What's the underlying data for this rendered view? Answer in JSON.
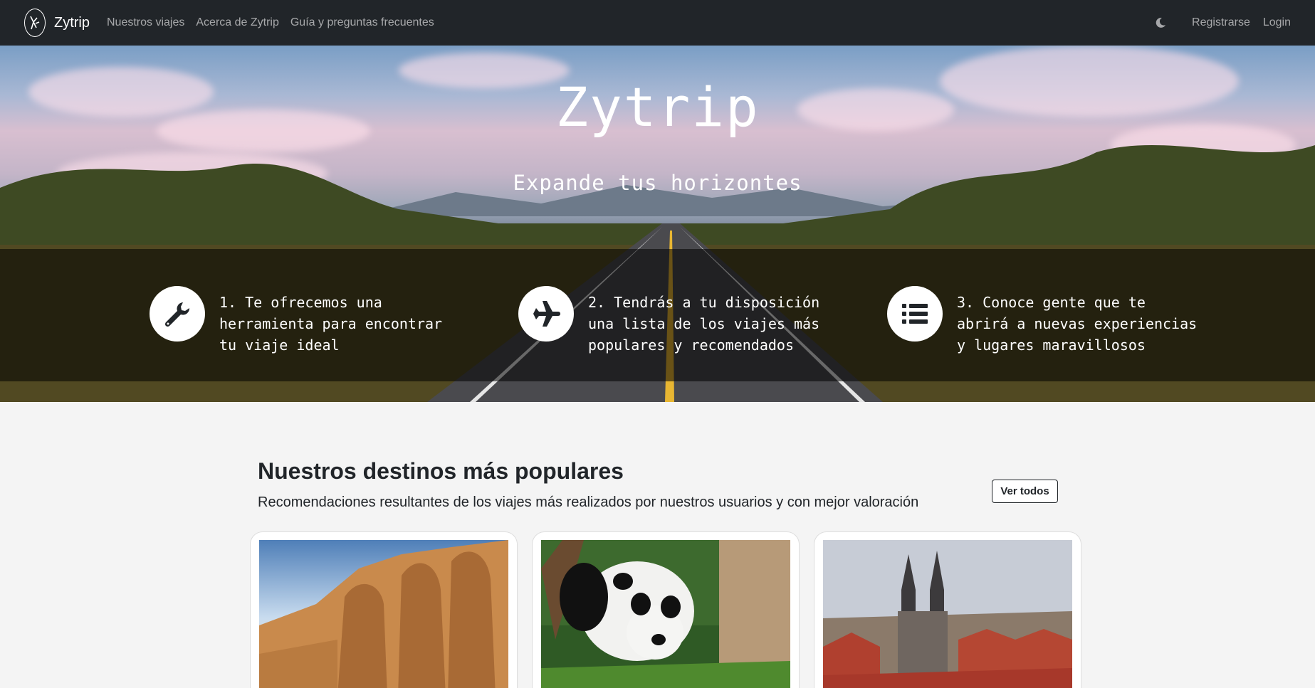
{
  "navbar": {
    "brand": "Zytrip",
    "links": [
      "Nuestros viajes",
      "Acerca de Zytrip",
      "Guía y preguntas frecuentes"
    ],
    "register": "Registrarse",
    "login": "Login"
  },
  "hero": {
    "title": "Zytrip",
    "subtitle": "Expande tus horizontes",
    "features": [
      {
        "icon": "wrench-icon",
        "text": "1. Te ofrecemos una herramienta para encontrar tu viaje ideal"
      },
      {
        "icon": "airplane-icon",
        "text": "2. Tendrás a tu disposición una lista de los viajes más populares y recomendados"
      },
      {
        "icon": "list-icon",
        "text": "3. Conoce gente que te abrirá a nuevas experiencias y lugares maravillosos"
      }
    ]
  },
  "popular": {
    "title": "Nuestros destinos más populares",
    "subtitle": "Recomendaciones resultantes de los viajes más realizados por nuestros usuarios y con mejor valoración",
    "see_all": "Ver todos"
  },
  "colors": {
    "navbar": "#212529",
    "background": "#f4f4f4"
  }
}
